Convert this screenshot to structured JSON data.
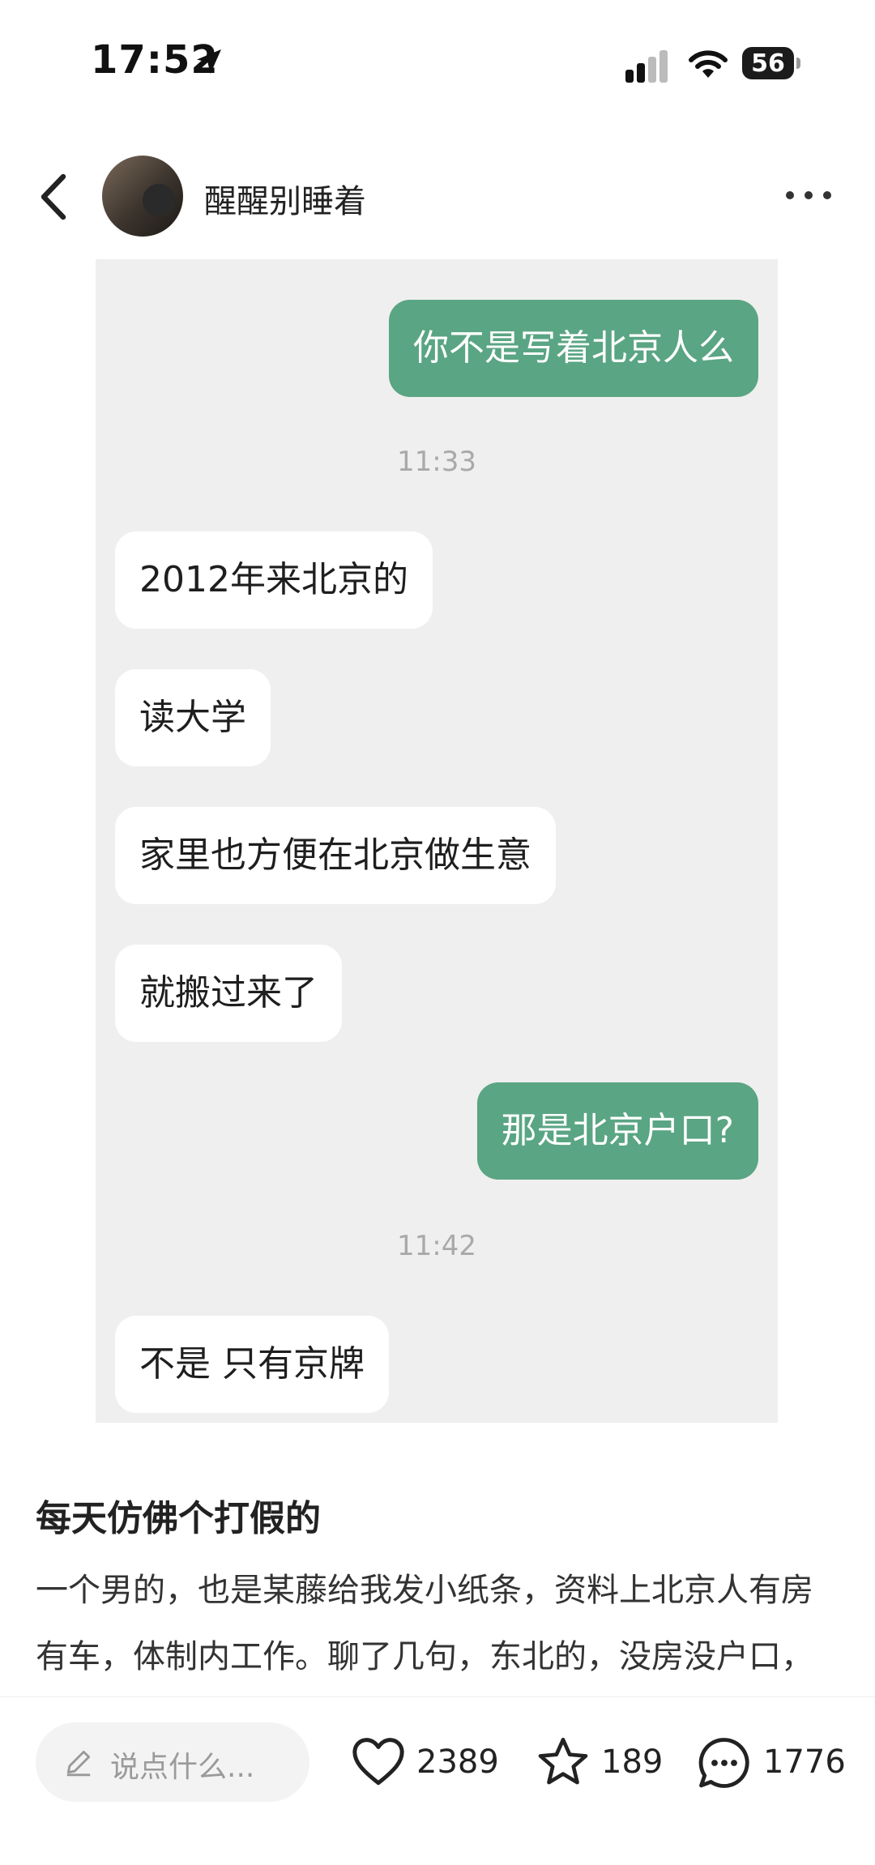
{
  "status_bar": {
    "time": "17:52",
    "battery": "56"
  },
  "header": {
    "author": "醒醒别睡着"
  },
  "chat": {
    "messages": [
      {
        "side": "out",
        "text": "你不是写着北京人么"
      },
      {
        "side": "time",
        "text": "11:33"
      },
      {
        "side": "in",
        "text": "2012年来北京的"
      },
      {
        "side": "in",
        "text": "读大学"
      },
      {
        "side": "in",
        "text": "家里也方便在北京做生意"
      },
      {
        "side": "in",
        "text": "就搬过来了"
      },
      {
        "side": "out",
        "text": "那是北京户口?"
      },
      {
        "side": "time",
        "text": "11:42"
      },
      {
        "side": "in",
        "text": "不是 只有京牌"
      }
    ]
  },
  "post": {
    "title": "每天仿佛个打假的",
    "body": "一个男的，也是某藤给我发小纸条，资料上北京人有房有车，体制内工作。聊了几句，东北的，没房没户口，说有个牌子，也不知道租的还是自己名下"
  },
  "bottom_bar": {
    "comment_placeholder": "说点什么...",
    "likes": "2389",
    "favorites": "189",
    "comments": "1776"
  },
  "colors": {
    "outgoing_bubble": "#5aa583",
    "chat_background": "#efefef"
  }
}
